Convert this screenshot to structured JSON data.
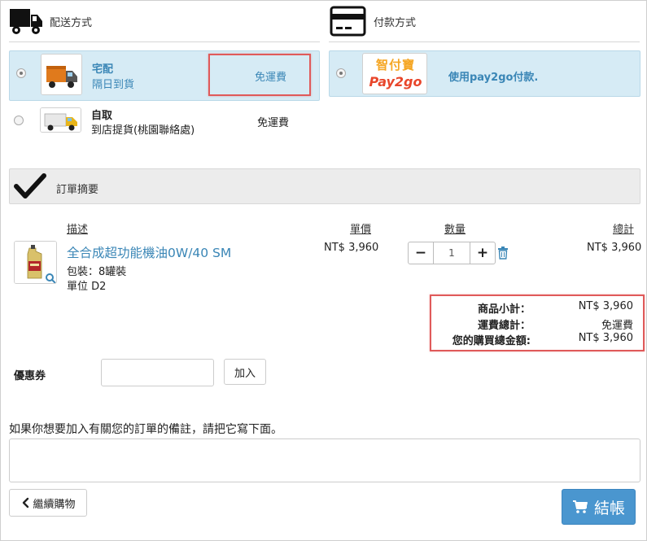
{
  "shipping": {
    "title": "配送方式",
    "options": [
      {
        "name": "宅配",
        "desc": "隔日到貨",
        "fee": "免運費",
        "selected": true
      },
      {
        "name": "自取",
        "desc": "到店提貨(桃園聯絡處)",
        "fee": "免運費",
        "selected": false
      }
    ]
  },
  "payment": {
    "title": "付款方式",
    "options": [
      {
        "logo_top": "智付寶",
        "logo_bottom": "Pay2go",
        "label": "使用pay2go付款.",
        "selected": true
      }
    ]
  },
  "order_summary": {
    "title": "訂單摘要",
    "columns": {
      "description": "描述",
      "unit_price": "單價",
      "quantity": "數量",
      "total": "總計"
    },
    "items": [
      {
        "name": "全合成超功能機油0W/40 SM",
        "package": "包裝：8罐裝",
        "unit": "單位 D2",
        "unit_price": "NT$ 3,960",
        "quantity": "1",
        "total": "NT$ 3,960"
      }
    ],
    "qty_minus": "−",
    "qty_plus": "+",
    "totals": [
      {
        "label": "商品小計：",
        "value": "NT$ 3,960"
      },
      {
        "label": "運費總計：",
        "value": "免運費"
      },
      {
        "label": "您的購買總金額:",
        "value": "NT$ 3,960"
      }
    ]
  },
  "coupon": {
    "label": "優惠券",
    "value": "",
    "button": "加入"
  },
  "notes": {
    "label": "如果你想要加入有關您的訂單的備註，請把它寫下面。",
    "value": ""
  },
  "actions": {
    "continue": "繼續購物",
    "checkout": "結帳"
  }
}
